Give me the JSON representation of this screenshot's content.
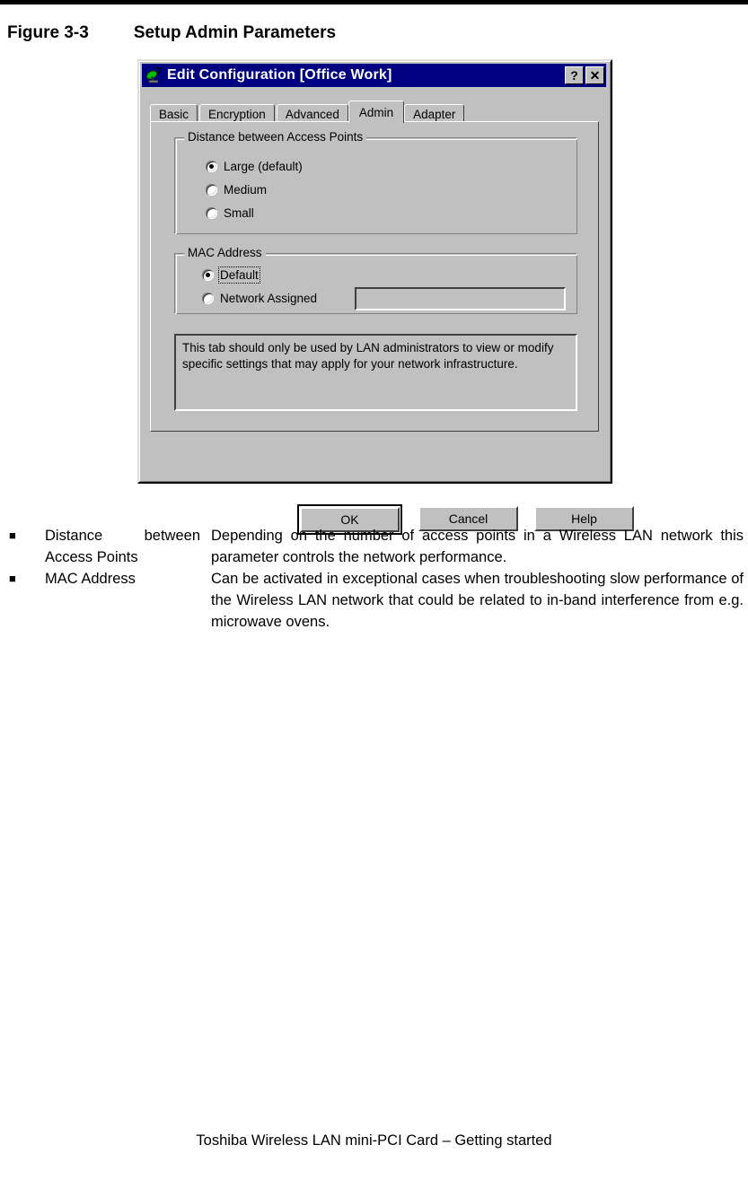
{
  "page": {
    "figure_number": "Figure 3-3",
    "figure_title": "Setup Admin Parameters",
    "footer": "Toshiba Wireless LAN mini-PCI Card – Getting started"
  },
  "dialog": {
    "title": "Edit Configuration [Office Work]",
    "icon": "wireless-antenna-icon",
    "titlebar_buttons": [
      {
        "name": "help-button",
        "glyph": "?"
      },
      {
        "name": "close-button",
        "glyph": "✕"
      }
    ],
    "tabs": [
      {
        "label": "Basic",
        "selected": false
      },
      {
        "label": "Encryption",
        "selected": false
      },
      {
        "label": "Advanced",
        "selected": false
      },
      {
        "label": "Admin",
        "selected": true
      },
      {
        "label": "Adapter",
        "selected": false
      }
    ],
    "groups": {
      "distance": {
        "title": "Distance between Access Points",
        "options": [
          {
            "label": "Large (default)",
            "accel": "L",
            "checked": true
          },
          {
            "label": "Medium",
            "accel": "M",
            "checked": false
          },
          {
            "label": "Small",
            "accel": "S",
            "checked": false
          }
        ]
      },
      "mac": {
        "title": "MAC Address",
        "options": [
          {
            "label": "Default",
            "accel": "D",
            "checked": true,
            "focused": true
          },
          {
            "label": "Network Assigned",
            "accel": "N",
            "checked": false,
            "focused": false
          }
        ],
        "address_field": {
          "value": "",
          "placeholder": "",
          "enabled": false
        }
      }
    },
    "info_text": "This tab should only be used by LAN administrators to view or modify specific settings that may apply for your network infrastructure.",
    "buttons": [
      {
        "label": "OK",
        "default": true
      },
      {
        "label": "Cancel",
        "default": false
      },
      {
        "label": "Help",
        "default": false
      }
    ]
  },
  "descriptions": [
    {
      "term_line1": "Distance between",
      "term_line2": "Access Points",
      "description": "Depending on the number of access points in a Wireless LAN network this parameter controls the network performance."
    },
    {
      "term_line1": "MAC Address",
      "term_line2": "",
      "description": "Can be activated in exceptional cases when troubleshooting slow performance of the Wireless LAN network that could be related to in-band interference from e.g. microwave ovens."
    }
  ]
}
